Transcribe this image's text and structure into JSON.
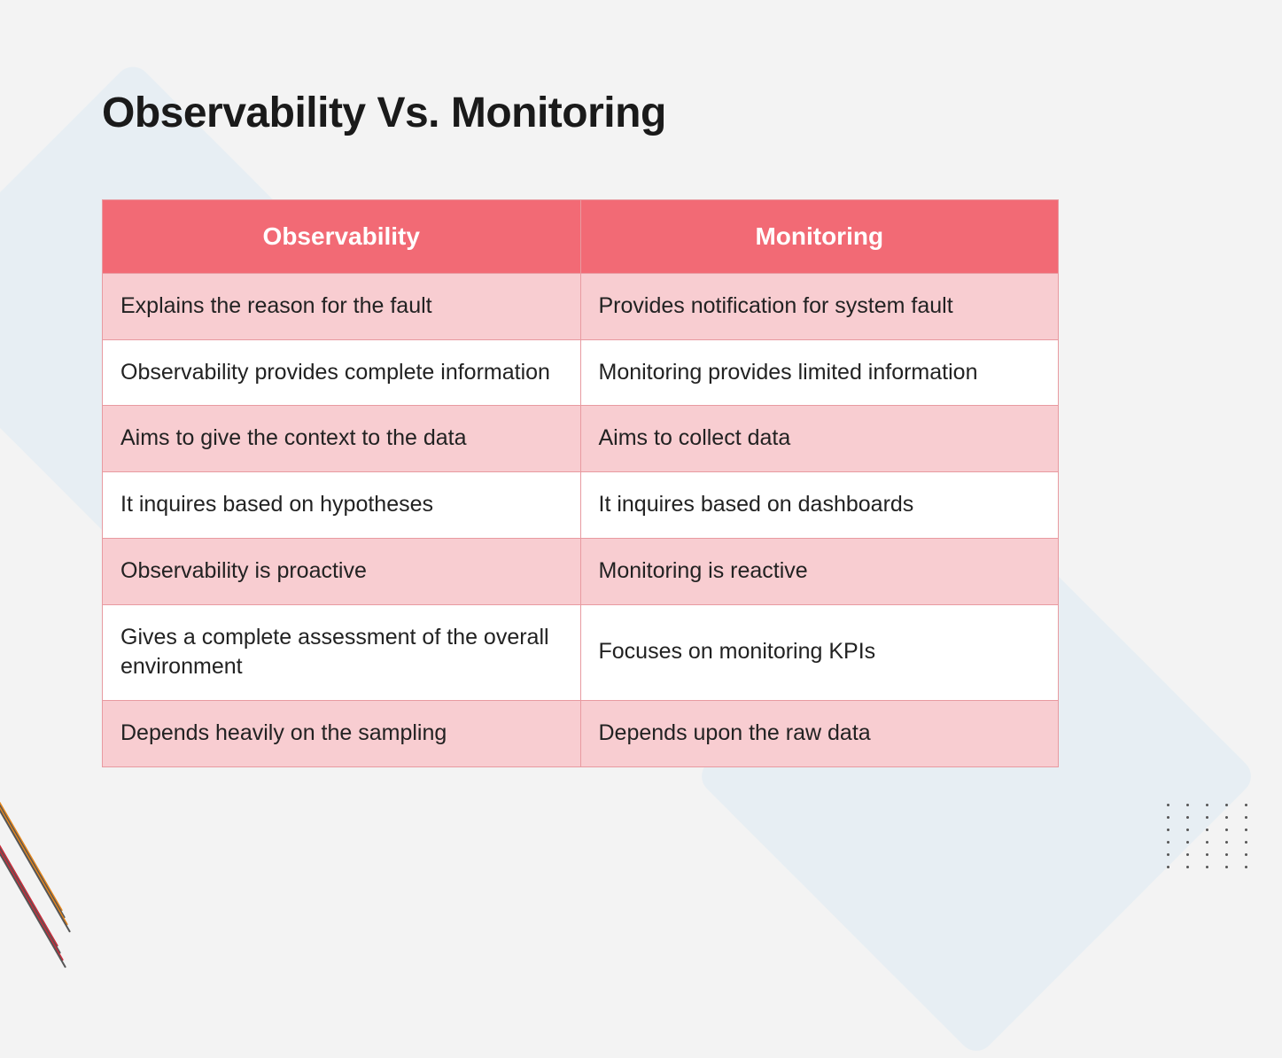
{
  "title": "Observability Vs. Monitoring",
  "headers": {
    "col1": "Observability",
    "col2": "Monitoring"
  },
  "rows": [
    {
      "col1": "Explains the reason for the fault",
      "col2": "Provides notification for system fault"
    },
    {
      "col1": "Observability provides complete information",
      "col2": "Monitoring provides limited information"
    },
    {
      "col1": "Aims to give the context to the data",
      "col2": "Aims to collect data"
    },
    {
      "col1": "It inquires based on hypotheses",
      "col2": "It inquires based on dashboards"
    },
    {
      "col1": "Observability is proactive",
      "col2": "Monitoring is reactive"
    },
    {
      "col1": "Gives a complete assessment of the overall environment",
      "col2": "Focuses on monitoring KPIs"
    },
    {
      "col1": "Depends heavily on the sampling",
      "col2": "Depends upon the raw data"
    }
  ]
}
